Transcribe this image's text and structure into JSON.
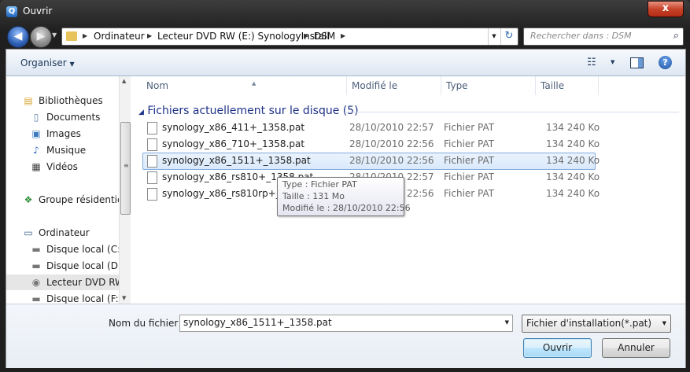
{
  "window": {
    "title": "Ouvrir",
    "close_label": "x"
  },
  "address": {
    "crumbs": [
      "Ordinateur",
      "Lecteur DVD RW (E:) SynologyInstall",
      "DSM"
    ],
    "search_placeholder": "Rechercher dans : DSM"
  },
  "toolbar": {
    "organiser_label": "Organiser"
  },
  "nav": {
    "items": [
      {
        "label": "Bibliothèques",
        "icon": "library-icon"
      },
      {
        "label": "Documents",
        "icon": "documents-icon"
      },
      {
        "label": "Images",
        "icon": "images-icon"
      },
      {
        "label": "Musique",
        "icon": "music-icon"
      },
      {
        "label": "Vidéos",
        "icon": "videos-icon"
      },
      {
        "label": "Groupe résidentiel",
        "icon": "homegroup-icon"
      },
      {
        "label": "Ordinateur",
        "icon": "computer-icon"
      },
      {
        "label": "Disque local (C:)",
        "icon": "drive-c-icon"
      },
      {
        "label": "Disque local (D:)",
        "icon": "drive-icon"
      },
      {
        "label": "Lecteur DVD RW",
        "icon": "dvd-drive-icon"
      },
      {
        "label": "Disque local (F:)",
        "icon": "drive-icon"
      }
    ]
  },
  "columns": {
    "name": "Nom",
    "modified": "Modifié le",
    "type": "Type",
    "size": "Taille"
  },
  "group": {
    "title": "Fichiers actuellement sur le disque (5)"
  },
  "files": [
    {
      "name": "synology_x86_411+_1358.pat",
      "modified": "28/10/2010 22:57",
      "type": "Fichier PAT",
      "size": "134 240 Ko"
    },
    {
      "name": "synology_x86_710+_1358.pat",
      "modified": "28/10/2010 22:56",
      "type": "Fichier PAT",
      "size": "134 240 Ko"
    },
    {
      "name": "synology_x86_1511+_1358.pat",
      "modified": "28/10/2010 22:56",
      "type": "Fichier PAT",
      "size": "134 240 Ko"
    },
    {
      "name": "synology_x86_rs810+_1358.pat",
      "modified": "28/10/2010 22:57",
      "type": "Fichier PAT",
      "size": "134 240 Ko"
    },
    {
      "name": "synology_x86_rs810rp+_1358.pat",
      "modified": "28/10/2010 22:56",
      "type": "Fichier PAT",
      "size": "134 240 Ko"
    }
  ],
  "tooltip": {
    "type_line": "Type : Fichier PAT",
    "size_line": "Taille : 131 Mo",
    "modified_line": "Modifié le : 28/10/2010 22:56"
  },
  "bottom": {
    "filename_label": "Nom du fichier :",
    "filename_value": "synology_x86_1511+_1358.pat",
    "filter_label": "Fichier d'installation(*.pat)",
    "open_label": "Ouvrir",
    "cancel_label": "Annuler"
  },
  "colors": {
    "accent": "#1e3287",
    "selection_border": "#84acdd"
  }
}
